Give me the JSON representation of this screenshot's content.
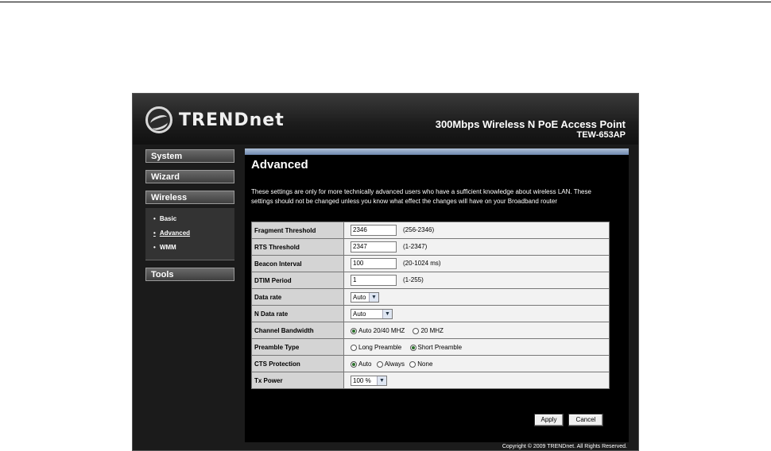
{
  "header": {
    "brand": "TRENDnet",
    "product_title": "300Mbps Wireless N PoE Access Point",
    "model": "TEW-653AP"
  },
  "sidebar": {
    "items": [
      {
        "label": "System"
      },
      {
        "label": "Wizard"
      },
      {
        "label": "Wireless"
      },
      {
        "label": "Tools"
      }
    ],
    "wireless_sub": [
      {
        "label": "Basic"
      },
      {
        "label": "Advanced"
      },
      {
        "label": "WMM"
      }
    ]
  },
  "main": {
    "title": "Advanced",
    "description": "These settings are only for more technically advanced users who have a sufficient knowledge about wireless LAN. These settings should not be changed unless you know what effect the changes will have on your Broadband router",
    "fragment": {
      "label": "Fragment Threshold",
      "value": "2346",
      "hint": "(256-2346)"
    },
    "rts": {
      "label": "RTS Threshold",
      "value": "2347",
      "hint": "(1-2347)"
    },
    "beacon": {
      "label": "Beacon Interval",
      "value": "100",
      "hint": "(20-1024 ms)"
    },
    "dtim": {
      "label": "DTIM Period",
      "value": "1",
      "hint": "(1-255)"
    },
    "data_rate": {
      "label": "Data rate",
      "selected": "Auto"
    },
    "n_data_rate": {
      "label": "N Data rate",
      "selected": "Auto"
    },
    "bandwidth": {
      "label": "Channel Bandwidth",
      "options": [
        "Auto 20/40 MHZ",
        "20 MHZ"
      ],
      "selected": "Auto 20/40 MHZ"
    },
    "preamble": {
      "label": "Preamble Type",
      "options": [
        "Long Preamble",
        "Short Preamble"
      ],
      "selected": "Short Preamble"
    },
    "cts": {
      "label": "CTS Protection",
      "options": [
        "Auto",
        "Always",
        "None"
      ],
      "selected": "Auto"
    },
    "tx_power": {
      "label": "Tx Power",
      "selected": "100 %"
    },
    "apply_label": "Apply",
    "cancel_label": "Cancel"
  },
  "footer": {
    "copyright": "Copyright © 2009 TRENDnet. All Rights Reserved."
  },
  "colors": {
    "content_bg": "#000000",
    "label_cell": "#d4d4d4",
    "value_cell": "#f2f2f2",
    "accent_bar": "#8aa0c2"
  }
}
